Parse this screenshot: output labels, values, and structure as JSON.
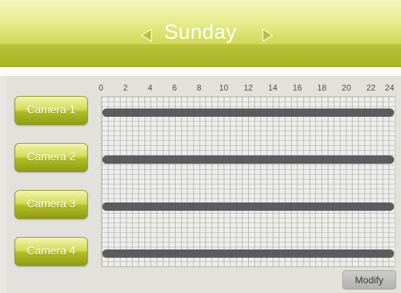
{
  "header": {
    "title": "Sunday",
    "prev_icon": "triangle-left-icon",
    "next_icon": "triangle-right-icon"
  },
  "timeline": {
    "hour_labels": [
      "0",
      "2",
      "4",
      "6",
      "8",
      "10",
      "12",
      "14",
      "16",
      "18",
      "20",
      "22",
      "24"
    ]
  },
  "cameras": [
    {
      "label": "Camera 1",
      "schedule": [
        {
          "start": 0,
          "end": 24
        }
      ]
    },
    {
      "label": "Camera 2",
      "schedule": [
        {
          "start": 0,
          "end": 24
        }
      ]
    },
    {
      "label": "Camera 3",
      "schedule": [
        {
          "start": 0,
          "end": 24
        }
      ]
    },
    {
      "label": "Camera 4",
      "schedule": [
        {
          "start": 0,
          "end": 24
        }
      ]
    }
  ],
  "footer": {
    "modify_label": "Modify"
  },
  "colors": {
    "accent": "#c8d24a",
    "schedule_bar": "#5c5c5c",
    "background": "#e3e1db"
  }
}
